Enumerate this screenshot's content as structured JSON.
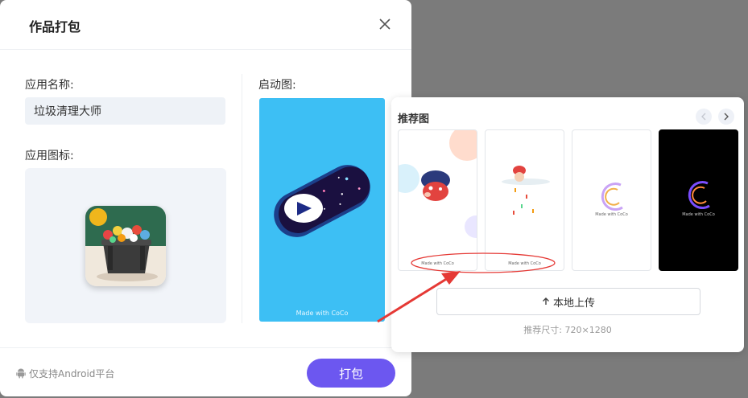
{
  "dialog": {
    "title": "作品打包",
    "app_name_label": "应用名称:",
    "app_name_value": "垃圾清理大师",
    "app_icon_label": "应用图标:",
    "splash_label": "启动图:",
    "splash_brand": "Made with CoCo",
    "footer_note": "仅支持Android平台",
    "pack_button": "打包"
  },
  "popup": {
    "title": "推荐图",
    "thumbs": [
      {
        "brand": "Made with CoCo"
      },
      {
        "brand": "Made with CoCo"
      },
      {
        "brand": "Made with CoCo"
      },
      {
        "brand": "Made with CoCo"
      }
    ],
    "upload_label": "本地上传",
    "size_hint": "推荐尺寸: 720×1280"
  },
  "colors": {
    "primary": "#6c57f0",
    "splash_bg": "#3dbff4",
    "annotation": "#e53935"
  }
}
